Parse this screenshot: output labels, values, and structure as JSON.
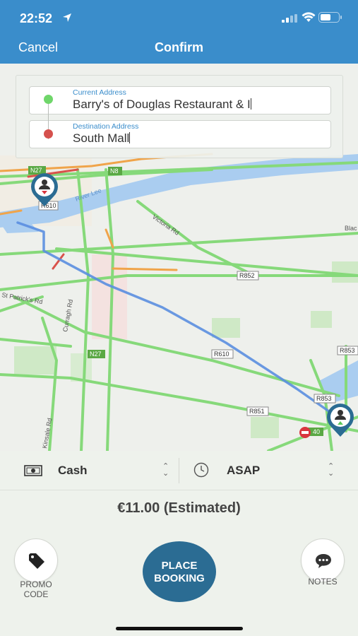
{
  "status_bar": {
    "time": "22:52"
  },
  "nav": {
    "cancel_label": "Cancel",
    "title": "Confirm"
  },
  "addresses": {
    "current": {
      "label": "Current Address",
      "value": "Barry's of Douglas Restaurant & I"
    },
    "destination": {
      "label": "Destination Address",
      "value": "South Mall"
    }
  },
  "map": {
    "road_labels": [
      "N27",
      "N8",
      "River Lee",
      "R610",
      "Victoria Rd",
      "Blac",
      "R852",
      "St Patrick's Rd",
      "Curragh Rd",
      "R610",
      "N27",
      "R853",
      "R853",
      "R851",
      "Kinsale Rd",
      "40"
    ]
  },
  "payment": {
    "method": "Cash",
    "time": "ASAP"
  },
  "price": "€11.00 (Estimated)",
  "actions": {
    "promo_label": "PROMO\nCODE",
    "place_booking_label": "PLACE\nBOOKING",
    "notes_label": "NOTES"
  },
  "colors": {
    "header": "#3a8dcb",
    "place_button": "#2b6c93",
    "route": "#5a8ee0"
  }
}
